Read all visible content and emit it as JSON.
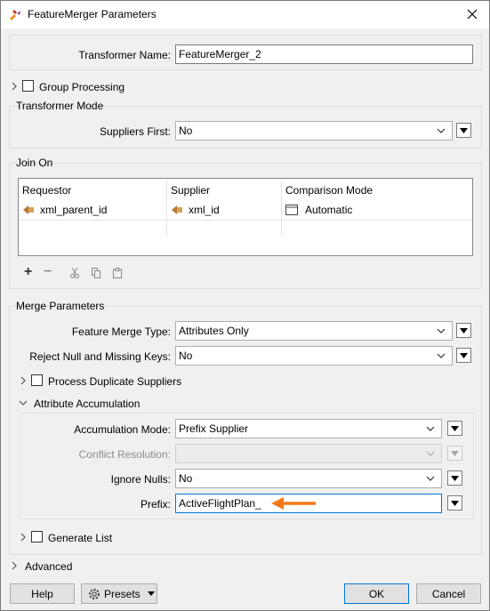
{
  "window": {
    "title": "FeatureMerger Parameters"
  },
  "transformer_name": {
    "label": "Transformer Name:",
    "value": "FeatureMerger_2"
  },
  "group_processing": {
    "label": "Group Processing",
    "checked": false
  },
  "transformer_mode": {
    "title": "Transformer Mode",
    "suppliers_first": {
      "label": "Suppliers First:",
      "value": "No"
    }
  },
  "join_on": {
    "title": "Join On",
    "columns": [
      "Requestor",
      "Supplier",
      "Comparison Mode"
    ],
    "rows": [
      {
        "requestor": "xml_parent_id",
        "supplier": "xml_id",
        "mode": "Automatic"
      }
    ],
    "toolbar": {
      "add": "+",
      "remove": "−"
    }
  },
  "merge_parameters": {
    "title": "Merge Parameters",
    "feature_merge_type": {
      "label": "Feature Merge Type:",
      "value": "Attributes Only"
    },
    "reject_null": {
      "label": "Reject Null and Missing Keys:",
      "value": "No"
    },
    "process_duplicate": {
      "label": "Process Duplicate Suppliers",
      "checked": false
    },
    "attribute_accumulation": {
      "label": "Attribute Accumulation",
      "accumulation_mode": {
        "label": "Accumulation Mode:",
        "value": "Prefix Supplier"
      },
      "conflict_resolution": {
        "label": "Conflict Resolution:",
        "value": ""
      },
      "ignore_nulls": {
        "label": "Ignore Nulls:",
        "value": "No"
      },
      "prefix": {
        "label": "Prefix:",
        "value": "ActiveFlightPlan_"
      }
    },
    "generate_list": {
      "label": "Generate List",
      "checked": false
    }
  },
  "advanced": {
    "label": "Advanced"
  },
  "footer": {
    "help": "Help",
    "presets": "Presets",
    "ok": "OK",
    "cancel": "Cancel"
  },
  "colors": {
    "accent": "#0078d7",
    "arrow": "#f07818"
  }
}
